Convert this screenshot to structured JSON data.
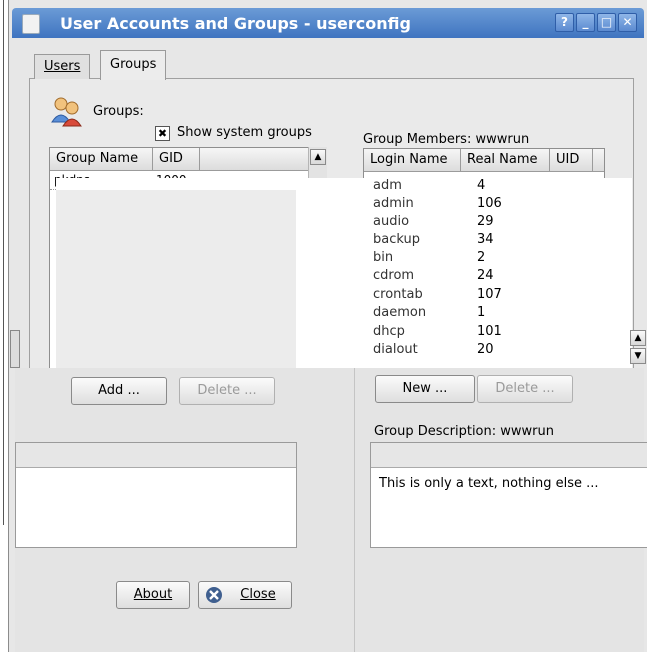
{
  "window": {
    "title": "User Accounts and Groups - userconfig",
    "help": "?",
    "minimize": "_",
    "maximize": "□",
    "close": "✕"
  },
  "tabs": [
    {
      "label": "Users"
    },
    {
      "label": "Groups"
    }
  ],
  "groups": {
    "label": "Groups:",
    "show_system": {
      "label": "Show system groups",
      "checked": true,
      "mark": "✖"
    },
    "columns": [
      "Group Name",
      "GID"
    ],
    "rows": [
      {
        "name": "pkdns",
        "gid": "1000"
      }
    ],
    "add_button": "Add ...",
    "delete_button": "Delete ..."
  },
  "members": {
    "label": "Group Members: wwwrun",
    "columns": [
      "Login Name",
      "Real Name",
      "UID"
    ],
    "rows": [
      {
        "login": "adm",
        "uid": "4"
      },
      {
        "login": "admin",
        "uid": "106"
      },
      {
        "login": "audio",
        "uid": "29"
      },
      {
        "login": "backup",
        "uid": "34"
      },
      {
        "login": "bin",
        "uid": "2"
      },
      {
        "login": "cdrom",
        "uid": "24"
      },
      {
        "login": "crontab",
        "uid": "107"
      },
      {
        "login": "daemon",
        "uid": "1"
      },
      {
        "login": "dhcp",
        "uid": "101"
      },
      {
        "login": "dialout",
        "uid": "20"
      }
    ],
    "new_button": "New ...",
    "delete_button": "Delete ..."
  },
  "description": {
    "label": "Group Description: wwwrun",
    "text": "This is only a text, nothing else ..."
  },
  "footer": {
    "about": "About",
    "close": "Close"
  }
}
